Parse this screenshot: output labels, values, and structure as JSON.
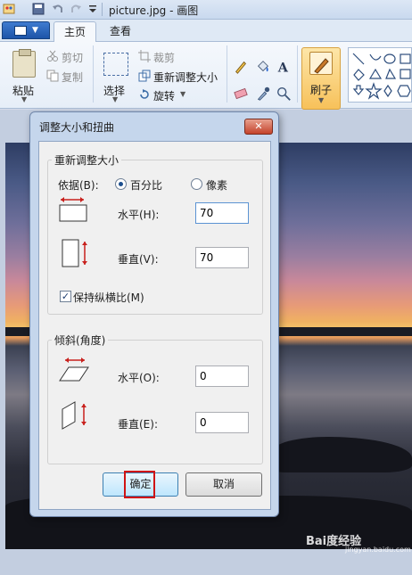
{
  "window": {
    "title": "picture.jpg - 画图"
  },
  "ribbon": {
    "tabs": [
      {
        "label": "主页",
        "active": true
      },
      {
        "label": "查看",
        "active": false
      }
    ],
    "clipboard": {
      "paste_label": "粘贴",
      "cut_label": "剪切",
      "copy_label": "复制"
    },
    "image": {
      "select_label": "选择",
      "crop_label": "裁剪",
      "resize_label": "重新调整大小",
      "rotate_label": "旋转"
    },
    "tools": {
      "text_tool_glyph": "A"
    },
    "brushes_label": "刷子"
  },
  "dialog": {
    "title": "调整大小和扭曲",
    "close_glyph": "✕",
    "resize_group": {
      "legend": "重新调整大小",
      "by_label": "依据(B):",
      "option_percent": "百分比",
      "option_pixels": "像素",
      "selected": "百分比",
      "horizontal_label": "水平(H):",
      "horizontal_value": "70",
      "vertical_label": "垂直(V):",
      "vertical_value": "70",
      "keep_ratio_label": "保持纵横比(M)",
      "keep_ratio_checked": true,
      "checkmark": "✓"
    },
    "skew_group": {
      "legend": "倾斜(角度)",
      "horizontal_label": "水平(O):",
      "horizontal_value": "0",
      "vertical_label": "垂直(E):",
      "vertical_value": "0"
    },
    "ok_label": "确定",
    "cancel_label": "取消"
  },
  "watermark": {
    "text": "Bai度经验",
    "sub": "jingyan.baidu.com"
  },
  "colors": {
    "accent_red": "#d01414",
    "arrow_red": "#c8201c",
    "file_button": "#1d55a8"
  }
}
